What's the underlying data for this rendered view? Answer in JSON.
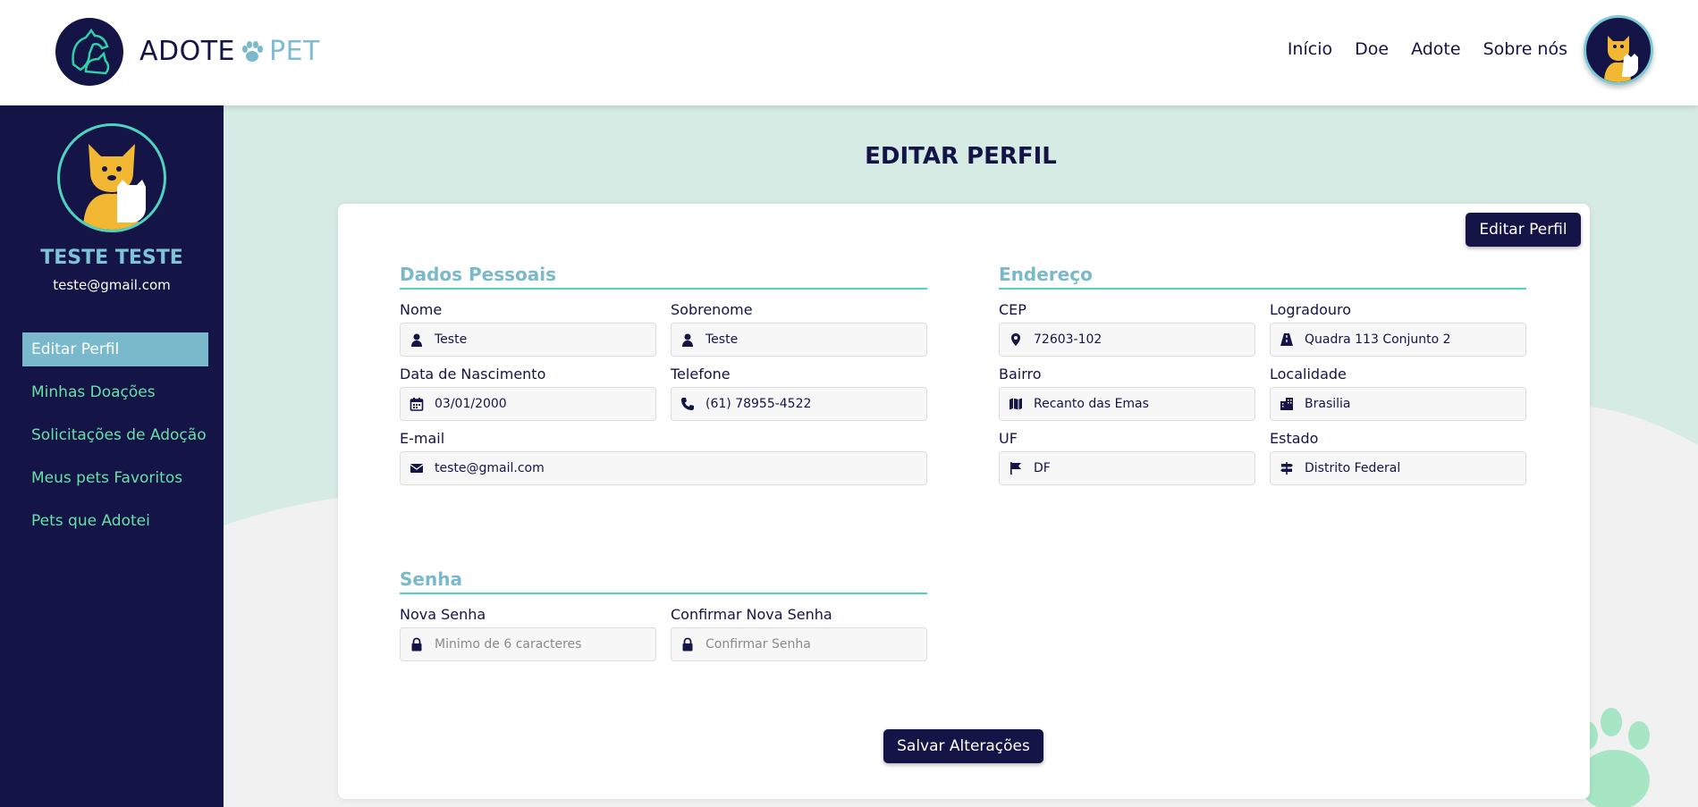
{
  "header": {
    "logo_word1": "ADOTE",
    "logo_word2": "PET",
    "nav": [
      "Início",
      "Doe",
      "Adote",
      "Sobre nós"
    ]
  },
  "sidebar": {
    "name": "TESTE TESTE",
    "email": "teste@gmail.com",
    "items": [
      {
        "label": "Editar Perfil",
        "active": true
      },
      {
        "label": "Minhas Doações",
        "active": false
      },
      {
        "label": "Solicitações de Adoção",
        "active": false
      },
      {
        "label": "Meus pets Favoritos",
        "active": false
      },
      {
        "label": "Pets que Adotei",
        "active": false
      }
    ]
  },
  "main": {
    "title": "EDITAR PERFIL",
    "edit_button": "Editar Perfil",
    "save_button": "Salvar Alterações"
  },
  "personal": {
    "title": "Dados Pessoais",
    "nome": {
      "label": "Nome",
      "value": "Teste",
      "icon": "user-icon"
    },
    "sobrenome": {
      "label": "Sobrenome",
      "value": "Teste",
      "icon": "user-icon"
    },
    "nascimento": {
      "label": "Data de Nascimento",
      "value": "03/01/2000",
      "icon": "calendar-icon"
    },
    "telefone": {
      "label": "Telefone",
      "value": "(61) 78955-4522",
      "icon": "phone-icon"
    },
    "email": {
      "label": "E-mail",
      "value": "teste@gmail.com",
      "icon": "envelope-icon"
    }
  },
  "address": {
    "title": "Endereço",
    "cep": {
      "label": "CEP",
      "value": "72603-102",
      "icon": "map-pin-icon"
    },
    "logradouro": {
      "label": "Logradouro",
      "value": "Quadra 113 Conjunto 2",
      "icon": "road-icon"
    },
    "bairro": {
      "label": "Bairro",
      "value": "Recanto das Emas",
      "icon": "map-icon"
    },
    "localidade": {
      "label": "Localidade",
      "value": "Brasilia",
      "icon": "city-icon"
    },
    "uf": {
      "label": "UF",
      "value": "DF",
      "icon": "flag-icon"
    },
    "estado": {
      "label": "Estado",
      "value": "Distrito Federal",
      "icon": "signpost-icon"
    }
  },
  "password": {
    "title": "Senha",
    "nova": {
      "label": "Nova Senha",
      "placeholder": "Minimo de 6 caracteres",
      "icon": "lock-icon"
    },
    "confirmar": {
      "label": "Confirmar Nova Senha",
      "placeholder": "Confirmar Senha",
      "icon": "lock-icon"
    }
  },
  "colors": {
    "navy": "#141446",
    "accent_blue": "#7ab8cc",
    "teal": "#4fd3c1",
    "mint_bg": "#d5ebe3",
    "green_link": "#69e0a6"
  }
}
